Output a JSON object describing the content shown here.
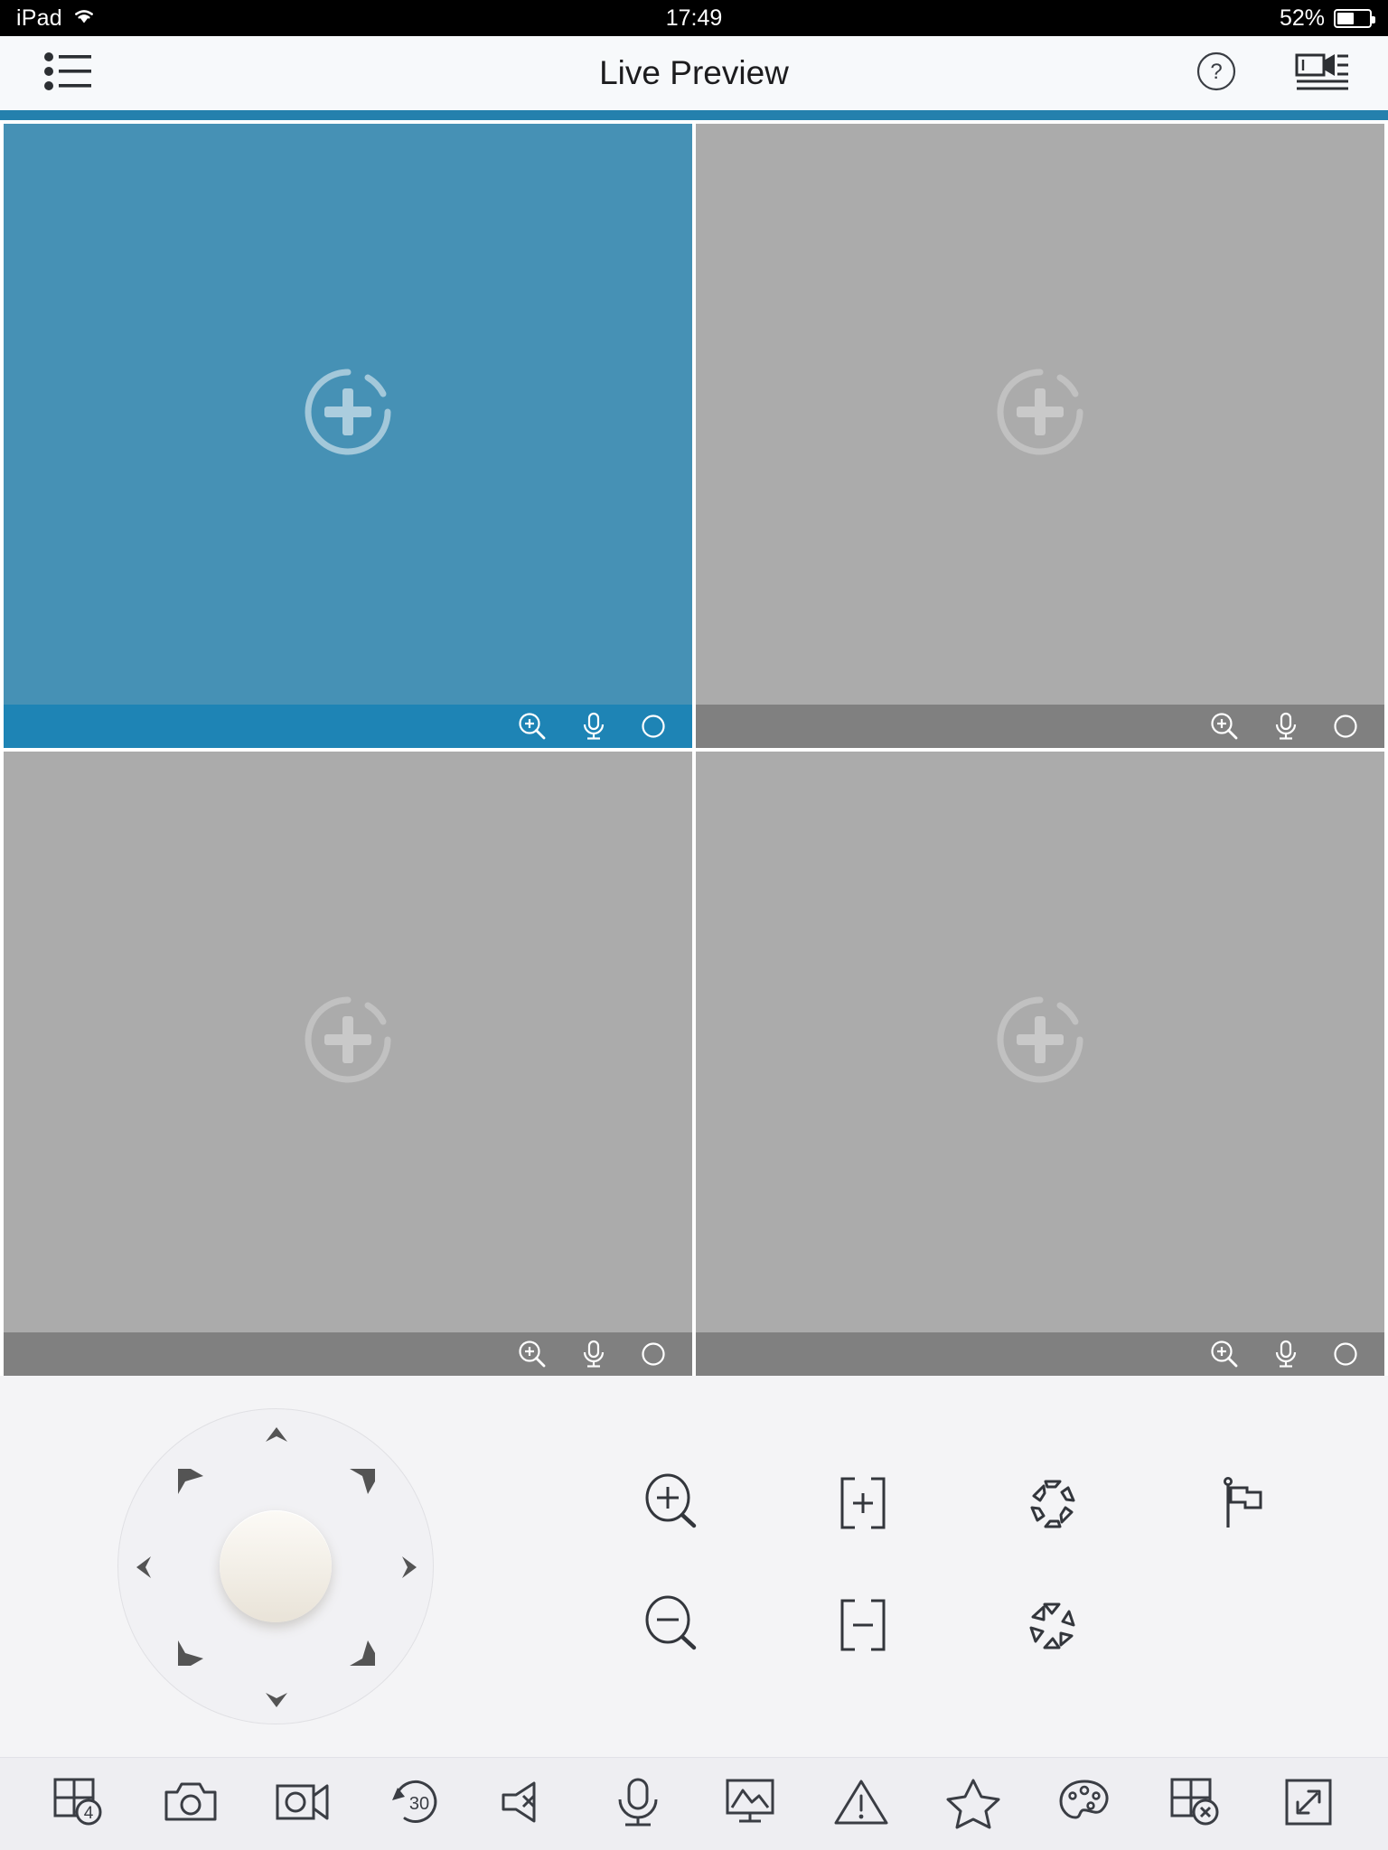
{
  "status_bar": {
    "device": "iPad",
    "wifi_icon": "wifi-icon",
    "time": "17:49",
    "battery_percent": "52%",
    "battery_level": 52
  },
  "nav_bar": {
    "menu_icon": "list-menu-icon",
    "title": "Live Preview",
    "help_icon": "help-circle-icon",
    "device_list_icon": "camera-list-icon",
    "accent_color": "#2480AD"
  },
  "grid": {
    "layout": "2x2",
    "colors": {
      "selected_body": "#4691B5",
      "selected_toolbar": "#1E84B5",
      "idle_body": "#ABABAB",
      "idle_toolbar": "#808080"
    },
    "cell_tools": [
      {
        "name": "digital-zoom-icon"
      },
      {
        "name": "audio-mic-icon"
      },
      {
        "name": "record-circle-icon"
      }
    ],
    "cells": [
      {
        "index": 1,
        "state": "selected",
        "placeholder_icon": "add-camera-plus-icon"
      },
      {
        "index": 2,
        "state": "idle",
        "placeholder_icon": "add-camera-plus-icon"
      },
      {
        "index": 3,
        "state": "idle",
        "placeholder_icon": "add-camera-plus-icon"
      },
      {
        "index": 4,
        "state": "idle",
        "placeholder_icon": "add-camera-plus-icon"
      }
    ]
  },
  "ptz": {
    "pad_name": "ptz-direction-pad",
    "knob_name": "ptz-joystick-knob",
    "directions": [
      "up",
      "up-left",
      "up-right",
      "left",
      "right",
      "down-left",
      "down-right",
      "down"
    ],
    "functions": [
      {
        "name": "zoom-in-icon",
        "row": 1,
        "col": 1
      },
      {
        "name": "focus-near-icon",
        "row": 1,
        "col": 2
      },
      {
        "name": "iris-open-icon",
        "row": 1,
        "col": 3
      },
      {
        "name": "preset-flag-icon",
        "row": 1,
        "col": 4
      },
      {
        "name": "zoom-out-icon",
        "row": 2,
        "col": 1
      },
      {
        "name": "focus-far-icon",
        "row": 2,
        "col": 2
      },
      {
        "name": "iris-close-icon",
        "row": 2,
        "col": 3
      }
    ]
  },
  "bottom_bar": {
    "items": [
      {
        "name": "window-division-icon",
        "badge": "4"
      },
      {
        "name": "snapshot-camera-icon",
        "badge": ""
      },
      {
        "name": "record-video-icon",
        "badge": ""
      },
      {
        "name": "instant-playback-icon",
        "badge": "30"
      },
      {
        "name": "speaker-mute-icon",
        "badge": ""
      },
      {
        "name": "two-way-audio-mic-icon",
        "badge": ""
      },
      {
        "name": "picture-monitor-icon",
        "badge": ""
      },
      {
        "name": "alarm-warning-icon",
        "badge": ""
      },
      {
        "name": "favorites-star-icon",
        "badge": ""
      },
      {
        "name": "image-palette-icon",
        "badge": ""
      },
      {
        "name": "close-all-windows-icon",
        "badge": ""
      },
      {
        "name": "fullscreen-expand-icon",
        "badge": ""
      }
    ]
  }
}
